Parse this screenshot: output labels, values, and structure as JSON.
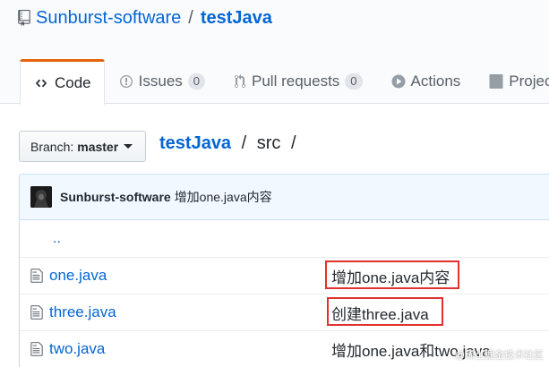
{
  "repo": {
    "owner": "Sunburst-software",
    "separator": "/",
    "name": "testJava"
  },
  "tabs": [
    {
      "label": "Code",
      "icon": "code-icon",
      "selected": true
    },
    {
      "label": "Issues",
      "icon": "issue-icon",
      "count": "0"
    },
    {
      "label": "Pull requests",
      "icon": "pull-request-icon",
      "count": "0"
    },
    {
      "label": "Actions",
      "icon": "play-icon"
    },
    {
      "label": "Projects",
      "icon": "project-icon"
    }
  ],
  "branch": {
    "prefix": "Branch:",
    "name": "master"
  },
  "breadcrumb": {
    "root": "testJava",
    "sep1": "/",
    "folder": "src",
    "sep2": "/"
  },
  "latest_commit": {
    "author": "Sunburst-software",
    "message": "增加one.java内容"
  },
  "files": {
    "parent": "..",
    "rows": [
      {
        "name": "one.java",
        "message": "增加one.java内容"
      },
      {
        "name": "three.java",
        "message": "创建three.java"
      },
      {
        "name": "two.java",
        "message": "增加one.java和two.java"
      }
    ]
  },
  "watermark": "@稀土掘金技术社区",
  "colors": {
    "link": "#0366d6",
    "highlight": "#e0312f",
    "tab_accent": "#e36209"
  }
}
